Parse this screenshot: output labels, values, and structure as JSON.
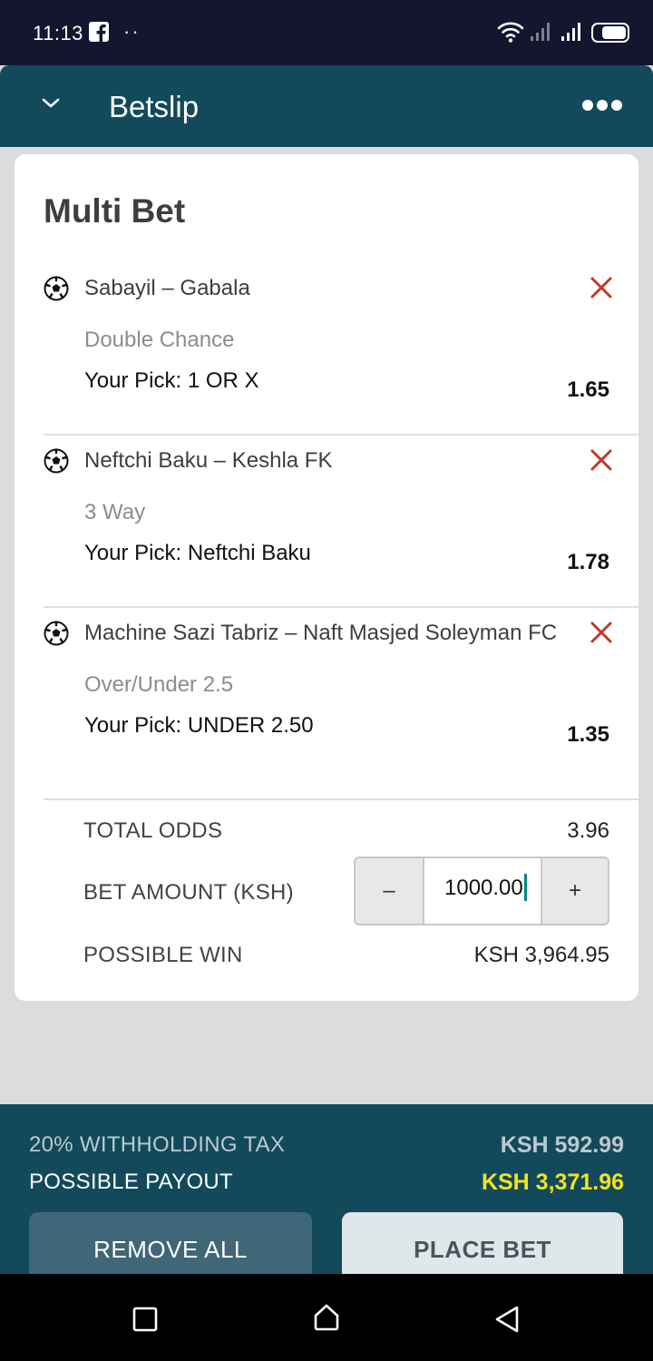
{
  "status_bar": {
    "time": "11:13"
  },
  "header": {
    "title": "Betslip"
  },
  "card": {
    "title": "Multi Bet",
    "bets": [
      {
        "match": "Sabayil – Gabala",
        "market": "Double Chance",
        "pick": "Your Pick: 1 OR X",
        "odds": "1.65"
      },
      {
        "match": "Neftchi Baku – Keshla FK",
        "market": "3 Way",
        "pick": "Your Pick: Neftchi Baku",
        "odds": "1.78"
      },
      {
        "match": "Machine Sazi Tabriz – Naft Masjed Soleyman FC",
        "market": "Over/Under 2.5",
        "pick": "Your Pick: UNDER 2.50",
        "odds": "1.35"
      }
    ]
  },
  "summary": {
    "total_odds_label": "TOTAL ODDS",
    "total_odds_value": "3.96",
    "bet_amount_label": "BET AMOUNT (KSH)",
    "bet_amount_value": "1000.00",
    "minus_label": "–",
    "plus_label": "+",
    "possible_win_label": "POSSIBLE WIN",
    "possible_win_value": "KSH 3,964.95"
  },
  "footer": {
    "tax_label": "20% WITHHOLDING TAX",
    "tax_value": "KSH 592.99",
    "payout_label": "POSSIBLE PAYOUT",
    "payout_value": "KSH 3,371.96",
    "remove_all_label": "REMOVE ALL",
    "place_bet_label": "PLACE BET"
  },
  "colors": {
    "header_bg": "#134a5b",
    "status_bg": "#13162e",
    "remove_icon": "#c0392b",
    "payout_accent": "#f2e324",
    "caret": "#00897b"
  },
  "icons": [
    "facebook-icon",
    "wifi-icon",
    "signal-icon",
    "battery-icon",
    "chevron-down-icon",
    "more-icon",
    "soccer-ball-icon",
    "close-icon",
    "nav-square-icon",
    "nav-home-icon",
    "nav-back-icon"
  ]
}
